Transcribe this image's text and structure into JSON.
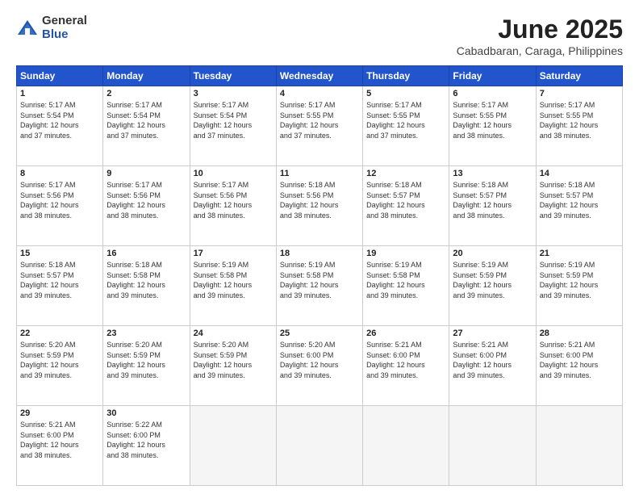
{
  "header": {
    "logo_general": "General",
    "logo_blue": "Blue",
    "title": "June 2025",
    "location": "Cabadbaran, Caraga, Philippines"
  },
  "days_of_week": [
    "Sunday",
    "Monday",
    "Tuesday",
    "Wednesday",
    "Thursday",
    "Friday",
    "Saturday"
  ],
  "weeks": [
    [
      {
        "day": 1,
        "sunrise": "5:17 AM",
        "sunset": "5:54 PM",
        "daylight": "12 hours and 37 minutes."
      },
      {
        "day": 2,
        "sunrise": "5:17 AM",
        "sunset": "5:54 PM",
        "daylight": "12 hours and 37 minutes."
      },
      {
        "day": 3,
        "sunrise": "5:17 AM",
        "sunset": "5:54 PM",
        "daylight": "12 hours and 37 minutes."
      },
      {
        "day": 4,
        "sunrise": "5:17 AM",
        "sunset": "5:55 PM",
        "daylight": "12 hours and 37 minutes."
      },
      {
        "day": 5,
        "sunrise": "5:17 AM",
        "sunset": "5:55 PM",
        "daylight": "12 hours and 37 minutes."
      },
      {
        "day": 6,
        "sunrise": "5:17 AM",
        "sunset": "5:55 PM",
        "daylight": "12 hours and 38 minutes."
      },
      {
        "day": 7,
        "sunrise": "5:17 AM",
        "sunset": "5:55 PM",
        "daylight": "12 hours and 38 minutes."
      }
    ],
    [
      {
        "day": 8,
        "sunrise": "5:17 AM",
        "sunset": "5:56 PM",
        "daylight": "12 hours and 38 minutes."
      },
      {
        "day": 9,
        "sunrise": "5:17 AM",
        "sunset": "5:56 PM",
        "daylight": "12 hours and 38 minutes."
      },
      {
        "day": 10,
        "sunrise": "5:17 AM",
        "sunset": "5:56 PM",
        "daylight": "12 hours and 38 minutes."
      },
      {
        "day": 11,
        "sunrise": "5:18 AM",
        "sunset": "5:56 PM",
        "daylight": "12 hours and 38 minutes."
      },
      {
        "day": 12,
        "sunrise": "5:18 AM",
        "sunset": "5:57 PM",
        "daylight": "12 hours and 38 minutes."
      },
      {
        "day": 13,
        "sunrise": "5:18 AM",
        "sunset": "5:57 PM",
        "daylight": "12 hours and 38 minutes."
      },
      {
        "day": 14,
        "sunrise": "5:18 AM",
        "sunset": "5:57 PM",
        "daylight": "12 hours and 39 minutes."
      }
    ],
    [
      {
        "day": 15,
        "sunrise": "5:18 AM",
        "sunset": "5:57 PM",
        "daylight": "12 hours and 39 minutes."
      },
      {
        "day": 16,
        "sunrise": "5:18 AM",
        "sunset": "5:58 PM",
        "daylight": "12 hours and 39 minutes."
      },
      {
        "day": 17,
        "sunrise": "5:19 AM",
        "sunset": "5:58 PM",
        "daylight": "12 hours and 39 minutes."
      },
      {
        "day": 18,
        "sunrise": "5:19 AM",
        "sunset": "5:58 PM",
        "daylight": "12 hours and 39 minutes."
      },
      {
        "day": 19,
        "sunrise": "5:19 AM",
        "sunset": "5:58 PM",
        "daylight": "12 hours and 39 minutes."
      },
      {
        "day": 20,
        "sunrise": "5:19 AM",
        "sunset": "5:59 PM",
        "daylight": "12 hours and 39 minutes."
      },
      {
        "day": 21,
        "sunrise": "5:19 AM",
        "sunset": "5:59 PM",
        "daylight": "12 hours and 39 minutes."
      }
    ],
    [
      {
        "day": 22,
        "sunrise": "5:20 AM",
        "sunset": "5:59 PM",
        "daylight": "12 hours and 39 minutes."
      },
      {
        "day": 23,
        "sunrise": "5:20 AM",
        "sunset": "5:59 PM",
        "daylight": "12 hours and 39 minutes."
      },
      {
        "day": 24,
        "sunrise": "5:20 AM",
        "sunset": "5:59 PM",
        "daylight": "12 hours and 39 minutes."
      },
      {
        "day": 25,
        "sunrise": "5:20 AM",
        "sunset": "6:00 PM",
        "daylight": "12 hours and 39 minutes."
      },
      {
        "day": 26,
        "sunrise": "5:21 AM",
        "sunset": "6:00 PM",
        "daylight": "12 hours and 39 minutes."
      },
      {
        "day": 27,
        "sunrise": "5:21 AM",
        "sunset": "6:00 PM",
        "daylight": "12 hours and 39 minutes."
      },
      {
        "day": 28,
        "sunrise": "5:21 AM",
        "sunset": "6:00 PM",
        "daylight": "12 hours and 39 minutes."
      }
    ],
    [
      {
        "day": 29,
        "sunrise": "5:21 AM",
        "sunset": "6:00 PM",
        "daylight": "12 hours and 38 minutes."
      },
      {
        "day": 30,
        "sunrise": "5:22 AM",
        "sunset": "6:00 PM",
        "daylight": "12 hours and 38 minutes."
      },
      null,
      null,
      null,
      null,
      null
    ]
  ]
}
